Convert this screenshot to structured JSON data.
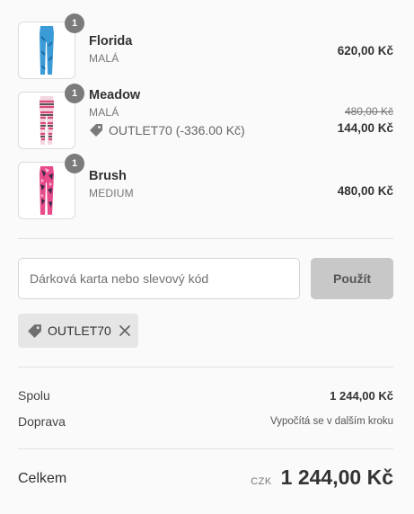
{
  "items": [
    {
      "name": "Florida",
      "variant": "MALÁ",
      "quantity": "1",
      "price": "620,00 Kč",
      "image": "leggings-blue-pattern",
      "colors": [
        "#3a9bd6",
        "#1e6fa8"
      ]
    },
    {
      "name": "Meadow",
      "variant": "MALÁ",
      "quantity": "1",
      "old_price": "480,00 Kč",
      "price": "144,00 Kč",
      "discount_label": "OUTLET70 (-336.00 Kč)",
      "image": "leggings-striped",
      "colors": [
        "#d84a7a",
        "#2a2a2a"
      ]
    },
    {
      "name": "Brush",
      "variant": "MEDIUM",
      "quantity": "1",
      "price": "480,00 Kč",
      "image": "leggings-pink-camo",
      "colors": [
        "#e84b8a",
        "#3a2a4a"
      ]
    }
  ],
  "discount": {
    "placeholder": "Dárková karta nebo slevový kód",
    "apply_label": "Použít",
    "applied_code": "OUTLET70"
  },
  "summary": {
    "subtotal_label": "Spolu",
    "subtotal_value": "1 244,00 Kč",
    "shipping_label": "Doprava",
    "shipping_value": "Vypočítá se v dalším kroku"
  },
  "total": {
    "label": "Celkem",
    "currency": "CZK",
    "value": "1 244,00 Kč"
  }
}
